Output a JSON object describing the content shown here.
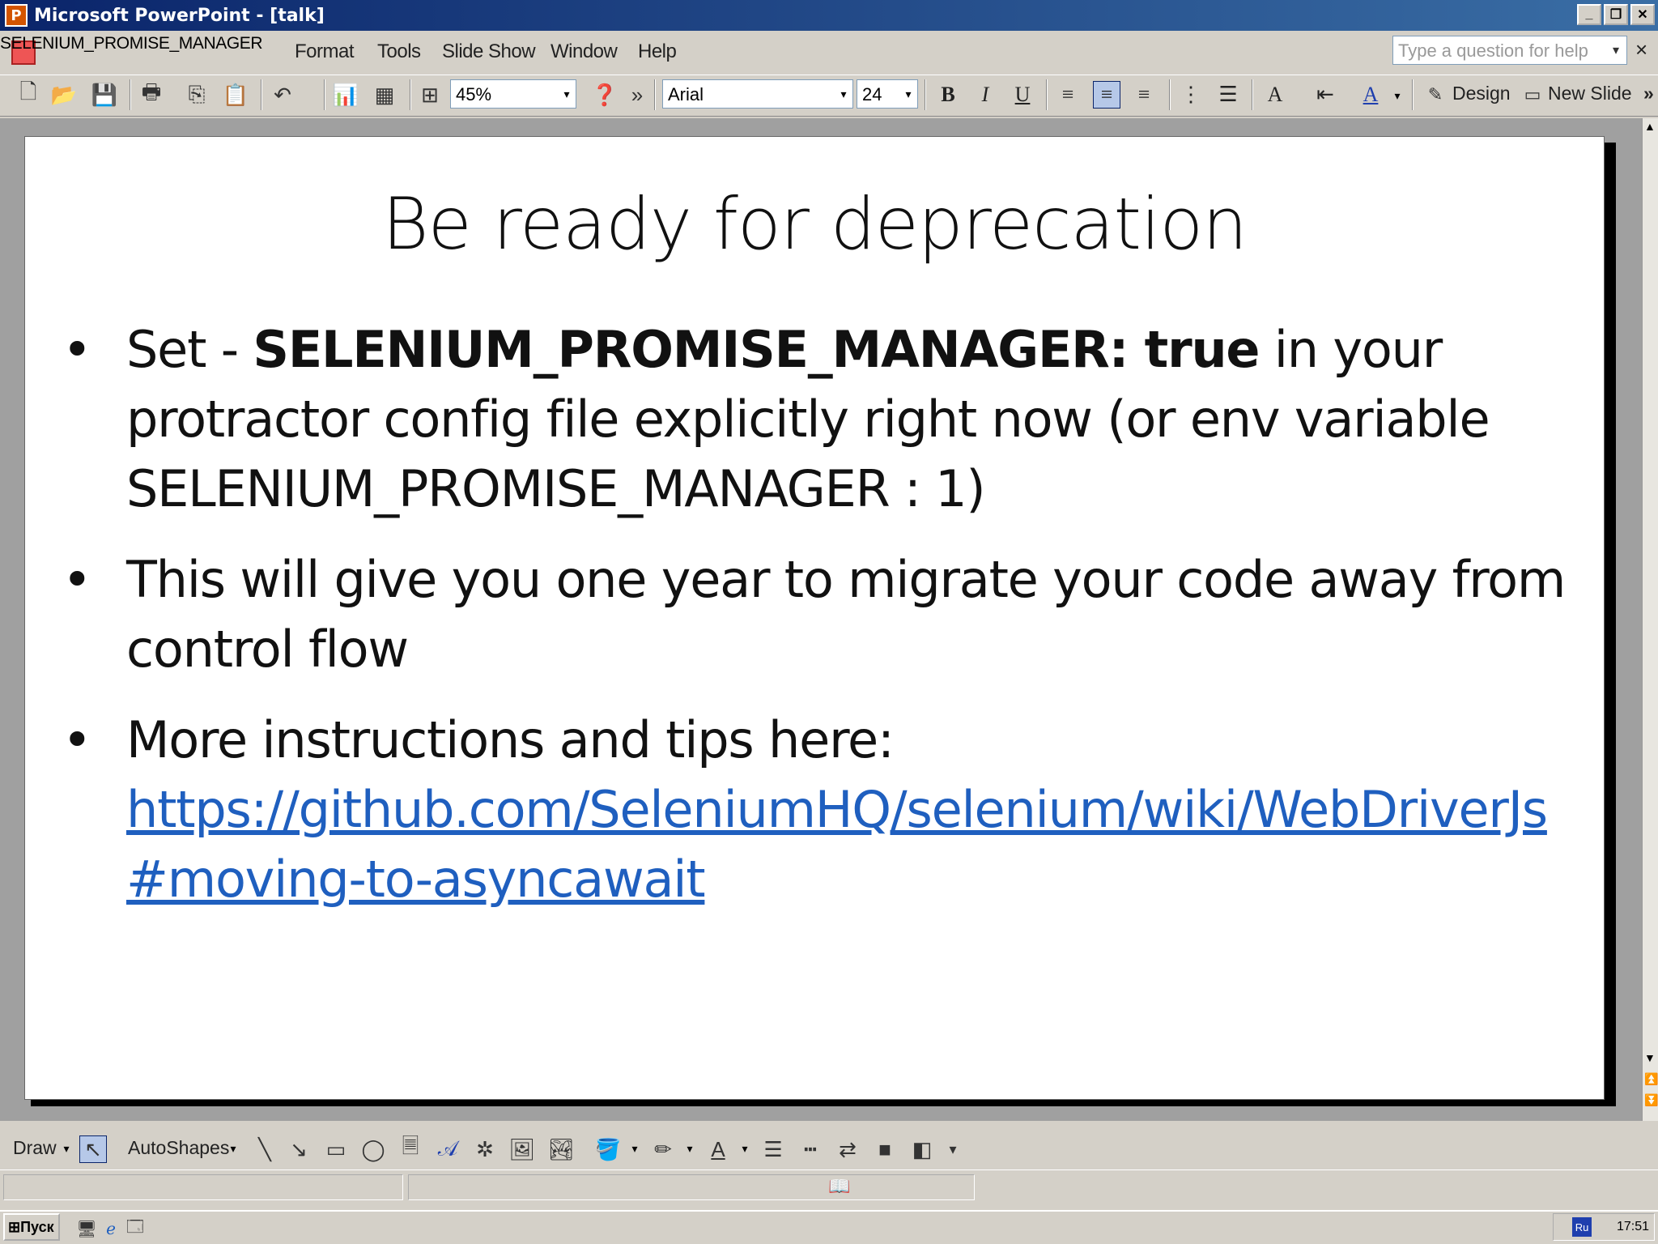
{
  "window": {
    "title": "Microsoft PowerPoint - [talk]",
    "app_icon_glyph": "P",
    "controls": {
      "minimize": "_",
      "restore": "❐",
      "close": "✕"
    }
  },
  "overlay_label": "SELENIUM_PROMISE_MANAGER",
  "menu": {
    "items": [
      "Format",
      "Tools",
      "Slide Show",
      "Window",
      "Help"
    ],
    "help_placeholder": "Type a question for help",
    "help_dropdown": "▾",
    "close_doc": "×"
  },
  "toolbar": {
    "zoom": "45%",
    "font": "Arial",
    "font_size": "24",
    "bold": "B",
    "italic": "I",
    "underline": "U",
    "design_label": "Design",
    "new_slide_label": "New Slide",
    "overflow": "»"
  },
  "slide": {
    "title": "Be ready for deprecation",
    "bullets": {
      "b1_pre": "Set - ",
      "b1_bold": "SELENIUM_PROMISE_MANAGER: true",
      "b1_post": " in your protractor config file explicitly right now (or env variable SELENIUM_PROMISE_MANAGER : 1)",
      "b2": "This will give you one year to migrate your code away from control flow",
      "b3": "More instructions and tips here:",
      "b3_link": "https://github.com/SeleniumHQ/selenium/wiki/WebDriverJs#moving-to-asyncawait"
    }
  },
  "drawbar": {
    "draw_label": "Draw",
    "autoshapes_label": "AutoShapes"
  },
  "taskbar": {
    "start_label": "Пуск",
    "lang": "Ru",
    "clock": "17:51"
  }
}
